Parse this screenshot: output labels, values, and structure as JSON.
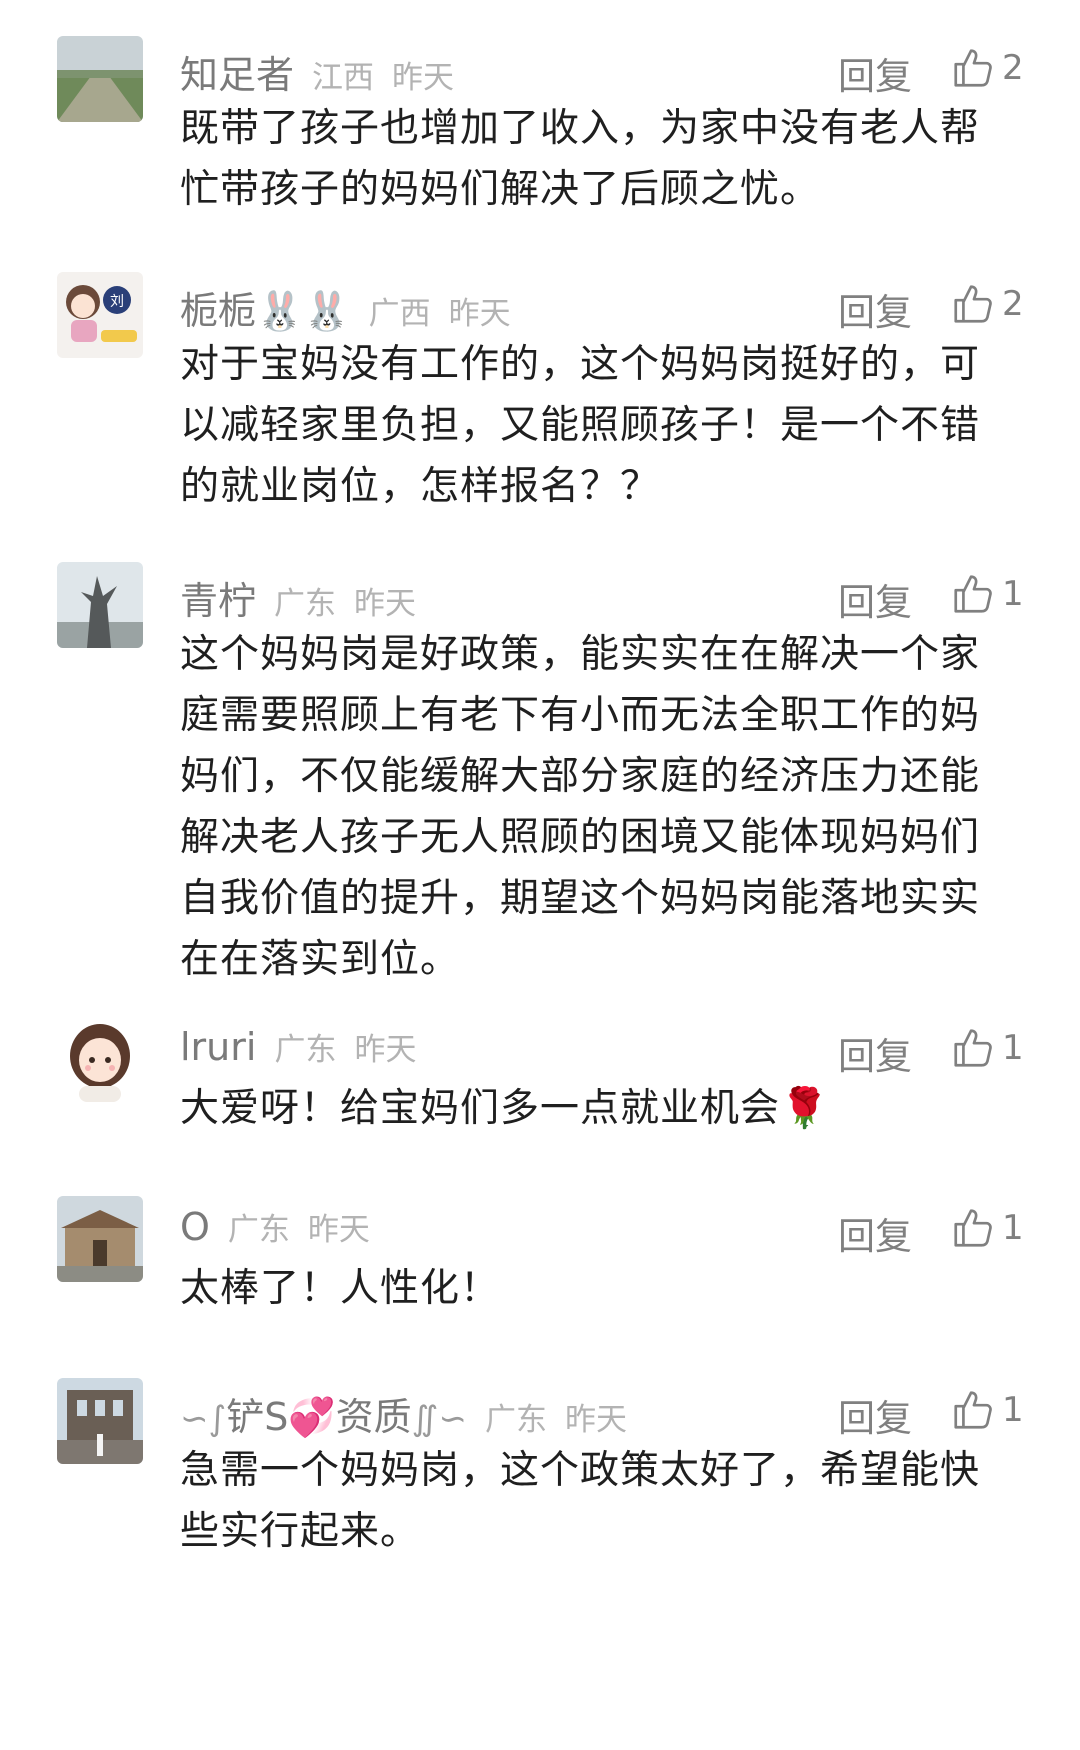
{
  "comments": [
    {
      "username": "知足者",
      "region": "江西",
      "time": "昨天",
      "reply_label": "回复",
      "likes": "2",
      "text": "既带了孩子也增加了收入，为家中没有老人帮忙带孩子的妈妈们解决了后顾之忧。",
      "avatar_icon": "field-road-photo"
    },
    {
      "username": "栀栀🐰🐰",
      "region": "广西",
      "time": "昨天",
      "reply_label": "回复",
      "likes": "2",
      "text": "对于宝妈没有工作的，这个妈妈岗挺好的，可以减轻家里负担，又能照顾孩子！是一个不错的就业岗位，怎样报名？？",
      "avatar_icon": "cartoon-girl-liu-avatar"
    },
    {
      "username": "青柠",
      "region": "广东",
      "time": "昨天",
      "reply_label": "回复",
      "likes": "1",
      "text": "这个妈妈岗是好政策，能实实在在解决一个家庭需要照顾上有老下有小而无法全职工作的妈妈们，不仅能缓解大部分家庭的经济压力还能解决老人孩子无人照顾的困境又能体现妈妈们自我价值的提升，期望这个妈妈岗能落地实实在在落实到位。",
      "avatar_icon": "sculpture-sky-photo"
    },
    {
      "username": "lruri",
      "region": "广东",
      "time": "昨天",
      "reply_label": "回复",
      "likes": "1",
      "text": "大爱呀！给宝妈们多一点就业机会🌹",
      "avatar_icon": "cartoon-girl-avatar"
    },
    {
      "username": "O",
      "region": "广东",
      "time": "昨天",
      "reply_label": "回复",
      "likes": "1",
      "text": "太棒了！人性化！",
      "avatar_icon": "temple-photo"
    },
    {
      "username": "铲S💞资质",
      "region": "广东",
      "time": "昨天",
      "reply_label": "回复",
      "likes": "1",
      "text": "急需一个妈妈岗，这个政策太好了，希望能快些实行起来。",
      "avatar_icon": "ruins-facade-photo"
    }
  ],
  "colors": {
    "username": "#7a7a7a",
    "meta": "#b3b3b3",
    "text": "#1f1f1f",
    "action": "#808080"
  }
}
